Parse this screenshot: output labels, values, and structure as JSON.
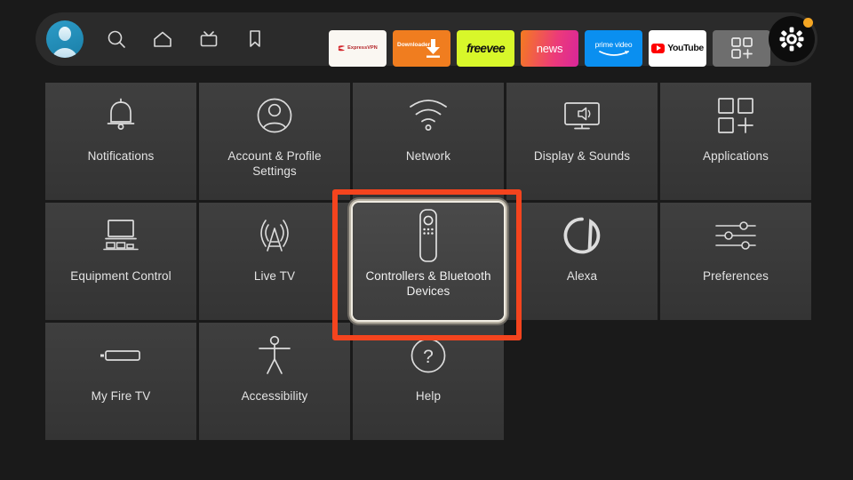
{
  "colors": {
    "background": "#1a1a1a",
    "navbar": "#2b2b2b",
    "tile": "#3a3a3a",
    "highlight_red": "#f4441e",
    "focus_silver": "#f0ece2",
    "accent_orange": "#f5a623",
    "avatar_blue": "#2d9cc8"
  },
  "navbar": {
    "avatar": {
      "name": "profile-avatar",
      "label": "Profile"
    },
    "icons": [
      {
        "name": "search-icon",
        "label": "Search"
      },
      {
        "name": "home-icon",
        "label": "Home"
      },
      {
        "name": "live-tv-icon",
        "label": "Live TV"
      },
      {
        "name": "bookmark-icon",
        "label": "Watchlist"
      }
    ],
    "apps": [
      {
        "name": "app-expressvpn",
        "label": "ExpressVPN"
      },
      {
        "name": "app-downloader",
        "label": "Downloader"
      },
      {
        "name": "app-freevee",
        "label": "freevee"
      },
      {
        "name": "app-news",
        "label": "news"
      },
      {
        "name": "app-prime-video",
        "label": "prime video"
      },
      {
        "name": "app-youtube",
        "label": "YouTube"
      },
      {
        "name": "app-grid",
        "label": "Apps"
      }
    ],
    "settings_button": {
      "name": "settings-gear-button",
      "label": "Settings",
      "has_notification_dot": true
    }
  },
  "settings_grid": {
    "rows": [
      [
        {
          "id": "notifications",
          "label": "Notifications",
          "icon": "bell-icon",
          "focused": false
        },
        {
          "id": "account-profile-settings",
          "label": "Account & Profile Settings",
          "icon": "person-circle-icon",
          "focused": false
        },
        {
          "id": "network",
          "label": "Network",
          "icon": "wifi-icon",
          "focused": false
        },
        {
          "id": "display-sounds",
          "label": "Display & Sounds",
          "icon": "tv-speaker-icon",
          "focused": false
        },
        {
          "id": "applications",
          "label": "Applications",
          "icon": "apps-grid-icon",
          "focused": false
        }
      ],
      [
        {
          "id": "equipment-control",
          "label": "Equipment Control",
          "icon": "tv-equipment-icon",
          "focused": false
        },
        {
          "id": "live-tv",
          "label": "Live TV",
          "icon": "antenna-tower-icon",
          "focused": false
        },
        {
          "id": "controllers-bluetooth-devices",
          "label": "Controllers & Bluetooth Devices",
          "icon": "remote-control-icon",
          "focused": true
        },
        {
          "id": "alexa",
          "label": "Alexa",
          "icon": "alexa-ring-icon",
          "focused": false
        },
        {
          "id": "preferences",
          "label": "Preferences",
          "icon": "sliders-icon",
          "focused": false
        }
      ],
      [
        {
          "id": "my-fire-tv",
          "label": "My Fire TV",
          "icon": "fire-tv-stick-icon",
          "focused": false
        },
        {
          "id": "accessibility",
          "label": "Accessibility",
          "icon": "accessibility-person-icon",
          "focused": false
        },
        {
          "id": "help",
          "label": "Help",
          "icon": "question-circle-icon",
          "focused": false
        }
      ]
    ]
  },
  "annotation": {
    "name": "highlight-box",
    "target": "controllers-bluetooth-devices",
    "color": "#f4441e"
  }
}
